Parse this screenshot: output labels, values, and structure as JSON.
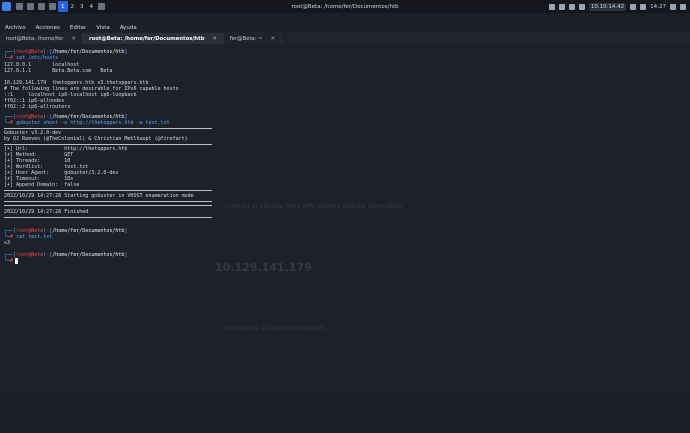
{
  "topbar": {
    "workspaces": [
      "1",
      "2",
      "3",
      "4"
    ],
    "window_title": "root@Beta: /home/fer/Documentos/htb",
    "ip": "10.10.14.42",
    "clock": "14:27"
  },
  "menu": [
    "Archivo",
    "Acciones",
    "Editar",
    "Vista",
    "Ayuda"
  ],
  "tabs": [
    {
      "label": "root@Beta: /home/fer"
    },
    {
      "label": "root@Beta: /home/fer/Documentos/htb"
    },
    {
      "label": "fer@Beta: ~"
    }
  ],
  "terminal": {
    "p1_user": "root@Beta",
    "p1_path": "/home/fer/Documentos/htb",
    "p1_cmd": "cat /etc/hosts",
    "hosts": [
      "127.0.0.1       localhost",
      "127.0.1.1       Beta.Beta.com   Beta",
      "",
      "10.129.141.179  thetoppers.htb s3.thetoppers.htb",
      "# The following lines are desirable for IPv6 capable hosts",
      "::1     localhost ip6-localhost ip6-loopback",
      "ff02::1 ip6-allnodes",
      "ff02::2 ip6-allrouters"
    ],
    "p2_cmd": "gobuster vhost -u http://thetoppers.htb -w test.txt",
    "gobuster_header": [
      "Gobuster v3.2.0-dev",
      "by OJ Reeves (@TheColonial) & Christian Mehlhaupt (@firefart)"
    ],
    "gobuster_config": [
      "[+] Url:            http://thetoppers.htb",
      "[+] Method:         GET",
      "[+] Threads:        10",
      "[+] Wordlist:       test.txt",
      "[+] User Agent:     gobuster/3.2.0-dev",
      "[+] Timeout:        10s",
      "[+] Append Domain:  false"
    ],
    "start_line": "2022/10/29 14:27:28 Starting gobuster in VHOST enumeration mode",
    "finish_line": "2022/10/29 14:27:28 Finished",
    "p3_cmd": "cat test.txt",
    "test_output": "s3"
  },
  "background_page": {
    "ip_heading": "10.129.141.179",
    "line1": "Connect to Starting Point VPN network and the information",
    "line2": "Interactive: 2/2 points on system"
  }
}
